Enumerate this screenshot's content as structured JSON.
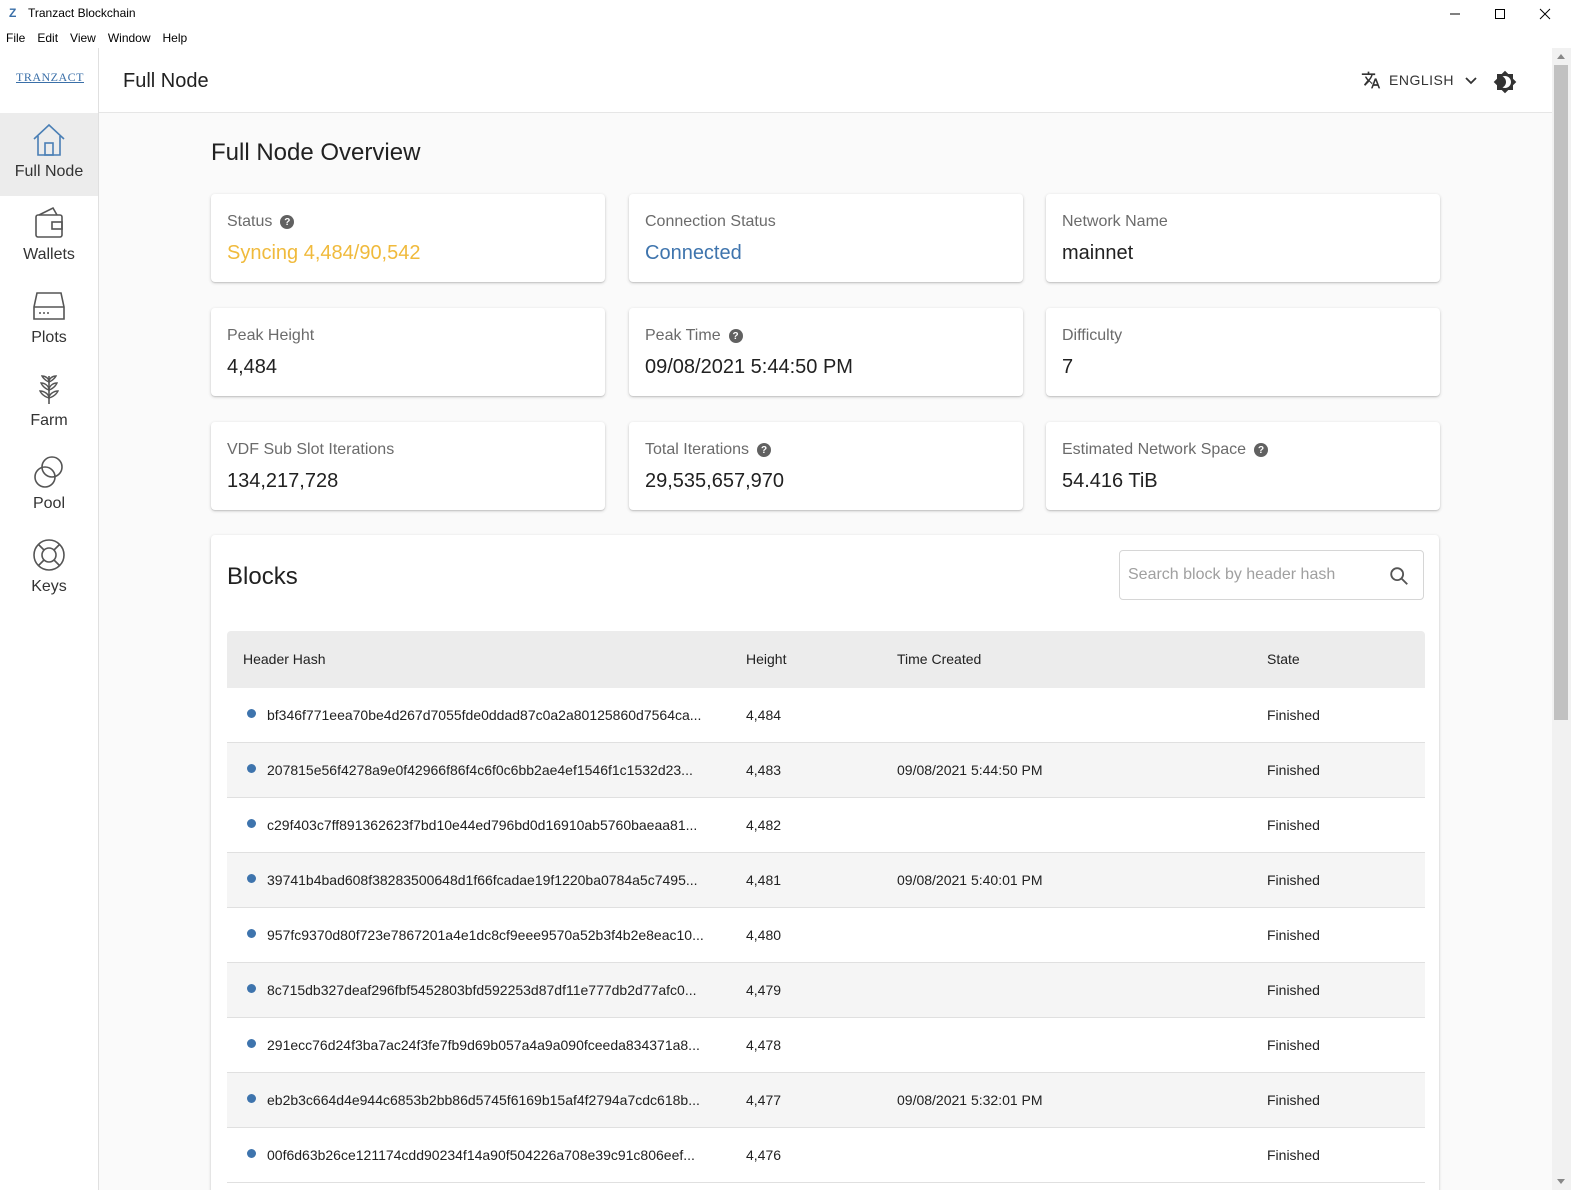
{
  "window": {
    "title": "Tranzact Blockchain",
    "app_icon": "Z"
  },
  "menu": [
    "File",
    "Edit",
    "View",
    "Window",
    "Help"
  ],
  "sidebar": {
    "logo": "TRANZACT",
    "items": [
      {
        "label": "Full Node",
        "icon": "home-icon"
      },
      {
        "label": "Wallets",
        "icon": "wallet-icon"
      },
      {
        "label": "Plots",
        "icon": "hard-drive-icon"
      },
      {
        "label": "Farm",
        "icon": "plant-icon"
      },
      {
        "label": "Pool",
        "icon": "pool-icon"
      },
      {
        "label": "Keys",
        "icon": "lifebuoy-icon"
      }
    ]
  },
  "header": {
    "title": "Full Node",
    "language": "ENGLISH"
  },
  "overview": {
    "title": "Full Node Overview",
    "cards": [
      {
        "label": "Status",
        "value": "Syncing 4,484/90,542",
        "help": true
      },
      {
        "label": "Connection Status",
        "value": "Connected",
        "help": false
      },
      {
        "label": "Network Name",
        "value": "mainnet",
        "help": false
      },
      {
        "label": "Peak Height",
        "value": "4,484",
        "help": false
      },
      {
        "label": "Peak Time",
        "value": "09/08/2021 5:44:50 PM",
        "help": true
      },
      {
        "label": "Difficulty",
        "value": "7",
        "help": false
      },
      {
        "label": "VDF Sub Slot Iterations",
        "value": "134,217,728",
        "help": false
      },
      {
        "label": "Total Iterations",
        "value": "29,535,657,970",
        "help": true
      },
      {
        "label": "Estimated Network Space",
        "value": "54.416 TiB",
        "help": true
      }
    ]
  },
  "blocks": {
    "title": "Blocks",
    "search_placeholder": "Search block by header hash",
    "columns": [
      "Header Hash",
      "Height",
      "Time Created",
      "State"
    ],
    "rows": [
      {
        "hash": "bf346f771eea70be4d267d7055fde0ddad87c0a2a80125860d7564ca...",
        "height": "4,484",
        "time": "",
        "state": "Finished"
      },
      {
        "hash": "207815e56f4278a9e0f42966f86f4c6f0c6bb2ae4ef1546f1c1532d23...",
        "height": "4,483",
        "time": "09/08/2021 5:44:50 PM",
        "state": "Finished"
      },
      {
        "hash": "c29f403c7ff891362623f7bd10e44ed796bd0d16910ab5760baeaa81...",
        "height": "4,482",
        "time": "",
        "state": "Finished"
      },
      {
        "hash": "39741b4bad608f38283500648d1f66fcadae19f1220ba0784a5c7495...",
        "height": "4,481",
        "time": "09/08/2021 5:40:01 PM",
        "state": "Finished"
      },
      {
        "hash": "957fc9370d80f723e7867201a4e1dc8cf9eee9570a52b3f4b2e8eac10...",
        "height": "4,480",
        "time": "",
        "state": "Finished"
      },
      {
        "hash": "8c715db327deaf296fbf5452803bfd592253d87df11e777db2d77afc0...",
        "height": "4,479",
        "time": "",
        "state": "Finished"
      },
      {
        "hash": "291ecc76d24f3ba7ac24f3fe7fb9d69b057a4a9a090fceeda834371a8...",
        "height": "4,478",
        "time": "",
        "state": "Finished"
      },
      {
        "hash": "eb2b3c664d4e944c6853b2bb86d5745f6169b15af4f2794a7cdc618b...",
        "height": "4,477",
        "time": "09/08/2021 5:32:01 PM",
        "state": "Finished"
      },
      {
        "hash": "00f6d63b26ce121174cdd90234f14a90f504226a708e39c91c806eef...",
        "height": "4,476",
        "time": "",
        "state": "Finished"
      }
    ]
  },
  "colors": {
    "syncing": "#f0ba3c",
    "connected": "#3e74ad",
    "row_dot": "#3e74ad"
  }
}
